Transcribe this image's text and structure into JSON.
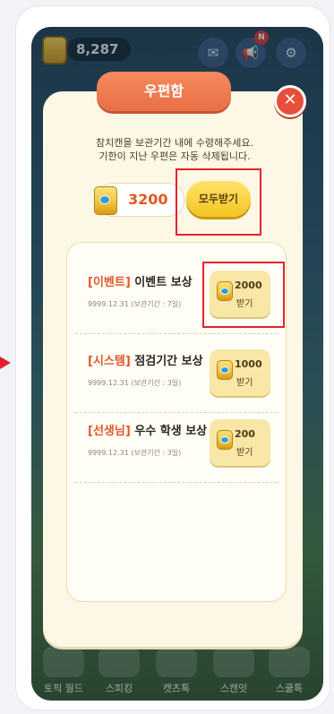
{
  "hud": {
    "can_count": "8,287",
    "notification_badge": "N"
  },
  "bottom_nav": [
    {
      "label": "토픽 월드"
    },
    {
      "label": "스피킹"
    },
    {
      "label": "캣츠톡"
    },
    {
      "label": "스캔잇"
    },
    {
      "label": "스쿨톡"
    }
  ],
  "mailbox": {
    "title": "우편함",
    "notice_line1": "참치캔을 보관기간 내에 수령해주세요.",
    "notice_line2": "기한이 지난 우편은 자동 삭제됩니다.",
    "total_cans": "3200",
    "claim_all_label": "모두받기",
    "items": [
      {
        "tag": "[이벤트]",
        "title": "이벤트 보상",
        "date": "9999.12.31 (보관기간 : 7일)",
        "amount": "2000",
        "claim_label": "받기"
      },
      {
        "tag": "[시스템]",
        "title": "점검기간 보상",
        "date": "9999.12.31 (보관기간 : 3일)",
        "amount": "1000",
        "claim_label": "받기"
      },
      {
        "tag": "[선생님]",
        "title": "우수 학생 보상",
        "date": "9999.12.31 (보관기간 : 3일)",
        "amount": "200",
        "claim_label": "받기"
      }
    ]
  },
  "colors": {
    "accent_orange": "#ea6f45",
    "highlight_red": "#e2232f",
    "claim_yellow": "#f4c51f"
  }
}
